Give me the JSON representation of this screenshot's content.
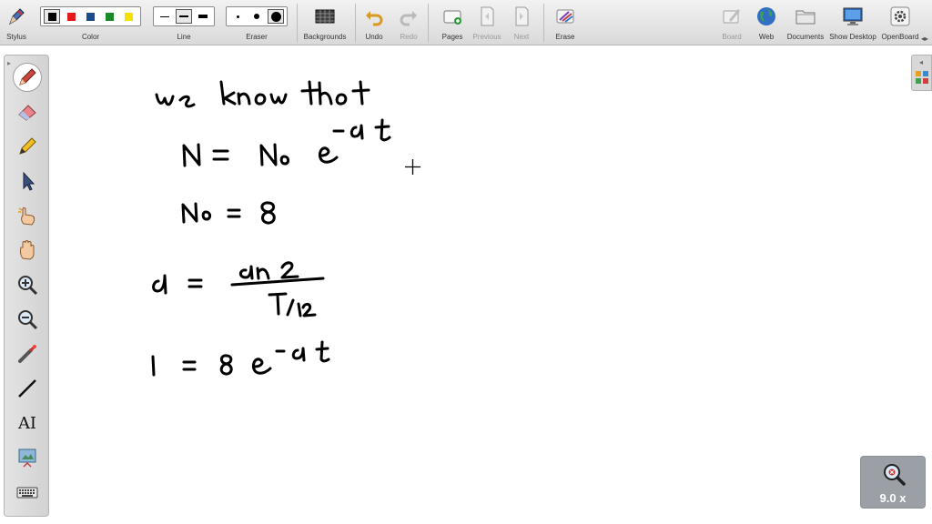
{
  "toolbar": {
    "stylus": "Stylus",
    "color": "Color",
    "line": "Line",
    "eraser": "Eraser",
    "backgrounds": "Backgrounds",
    "undo": "Undo",
    "redo": "Redo",
    "pages": "Pages",
    "previous": "Previous",
    "next": "Next",
    "erase": "Erase",
    "board": "Board",
    "web": "Web",
    "documents": "Documents",
    "show_desktop": "Show Desktop",
    "openboard": "OpenBoard",
    "colors": [
      "#000000",
      "#e41b1b",
      "#1a4d8c",
      "#1c8a2b",
      "#f5e000"
    ],
    "selected_color": "#000000"
  },
  "left_tools": [
    "pen-icon",
    "eraser-icon",
    "marker-icon",
    "selector-icon",
    "interact-icon",
    "hand-icon",
    "zoom-in-icon",
    "zoom-out-icon",
    "laser-icon",
    "line-icon",
    "text-icon",
    "capture-icon",
    "keyboard-icon"
  ],
  "left_tools_text": {
    "text_tool_glyph": "AI"
  },
  "board": {
    "ink_color": "#000000",
    "background": "#ffffff"
  },
  "zoom": {
    "value": "9.0 x"
  }
}
